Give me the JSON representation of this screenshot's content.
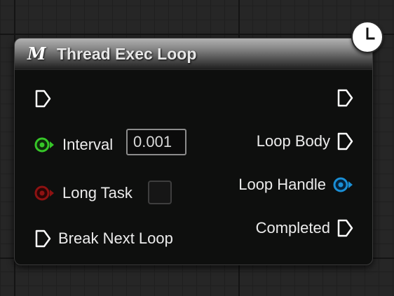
{
  "node": {
    "title": "Thread Exec Loop",
    "icon_glyph": "M",
    "icon_name": "macro-icon",
    "badge_icon": "clock-icon",
    "header_color": "#8b8b8b",
    "body_color": "#0e0f0e"
  },
  "inputs": [
    {
      "name": "exec-in",
      "label": "",
      "type": "exec",
      "color": "#ffffff"
    },
    {
      "name": "interval",
      "label": "Interval",
      "type": "float",
      "color": "#36c628",
      "value": "0.001"
    },
    {
      "name": "long-task",
      "label": "Long Task",
      "type": "bool",
      "color": "#8e1212",
      "checked": false
    },
    {
      "name": "break-next-loop",
      "label": "Break Next Loop",
      "type": "exec",
      "color": "#ffffff"
    }
  ],
  "outputs": [
    {
      "name": "exec-out",
      "label": "",
      "type": "exec",
      "color": "#ffffff"
    },
    {
      "name": "loop-body",
      "label": "Loop Body",
      "type": "exec",
      "color": "#ffffff"
    },
    {
      "name": "loop-handle",
      "label": "Loop Handle",
      "type": "struct",
      "color": "#1a8fd6"
    },
    {
      "name": "completed",
      "label": "Completed",
      "type": "exec",
      "color": "#ffffff"
    }
  ]
}
